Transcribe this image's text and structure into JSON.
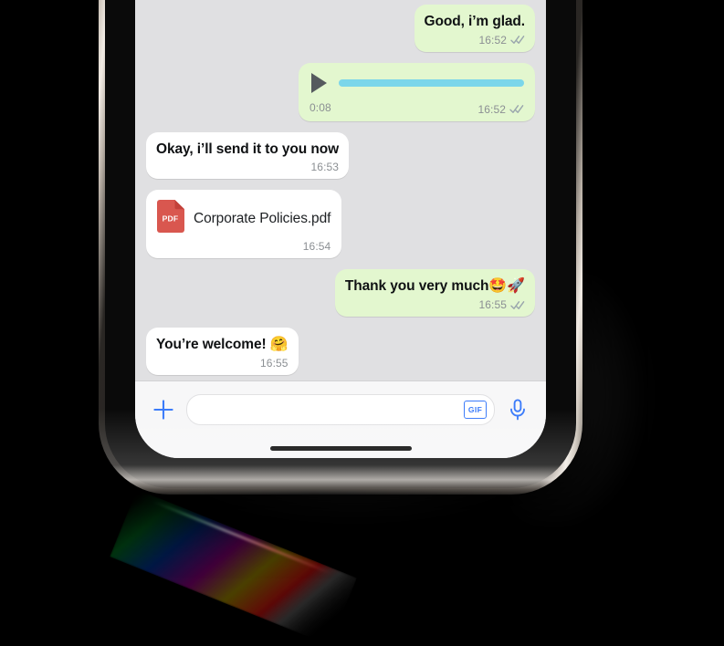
{
  "app": {
    "name": "whatsapp-chat",
    "background_color": "#000000",
    "screen_background": "#e0e0e2",
    "bubble_out_color": "#e3f7cf",
    "bubble_in_color": "#ffffff",
    "accent_color": "#3b7bfa",
    "waveform_color": "#7bd6ea",
    "pdf_icon_color": "#d9574f",
    "tick_color": "#9aa6ad"
  },
  "thread": {
    "messages": [
      {
        "id": "msg-good-im-glad",
        "direction": "out",
        "type": "text",
        "text": "Good, i’m glad.",
        "time": "16:52",
        "status": "read"
      },
      {
        "id": "msg-voice-note",
        "direction": "out",
        "type": "voice",
        "duration": "0:08",
        "time": "16:52",
        "status": "read",
        "play_icon": "play-icon"
      },
      {
        "id": "msg-okay-send",
        "direction": "in",
        "type": "text",
        "text": "Okay, i’ll send it to you now",
        "time": "16:53",
        "status": "none"
      },
      {
        "id": "msg-pdf-attachment",
        "direction": "in",
        "type": "document",
        "file_name": "Corporate Policies.pdf",
        "file_type_label": "PDF",
        "time": "16:54",
        "status": "none"
      },
      {
        "id": "msg-thank-you",
        "direction": "out",
        "type": "text",
        "text": "Thank you very much",
        "emoji": "🤩🚀",
        "time": "16:55",
        "status": "read"
      },
      {
        "id": "msg-youre-welcome",
        "direction": "in",
        "type": "text",
        "text": "You’re welcome! ",
        "emoji": "🤗",
        "time": "16:55",
        "status": "none"
      }
    ]
  },
  "composer": {
    "attach_label": "+",
    "input_value": "",
    "input_placeholder": "",
    "gif_label": "GIF",
    "mic_label": "mic"
  }
}
